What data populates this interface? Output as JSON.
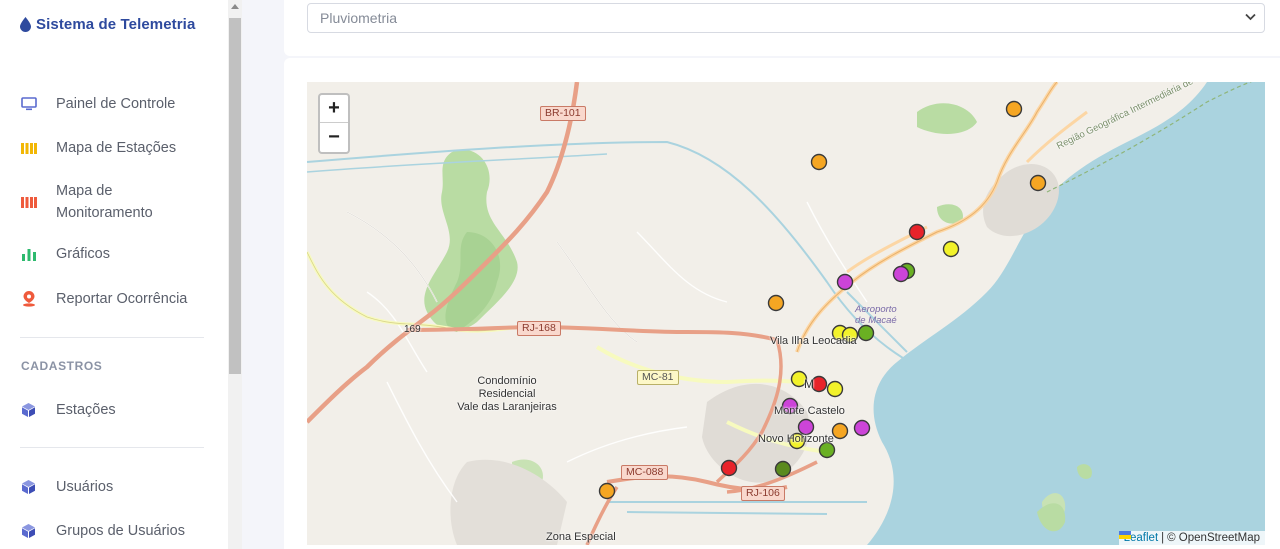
{
  "app": {
    "title": "Sistema de Telemetria"
  },
  "sidebar": {
    "items": [
      {
        "label": "Painel de Controle",
        "icon": "monitor-icon",
        "color": "#5a6acf"
      },
      {
        "label": "Mapa de Estações",
        "icon": "map-stations-icon",
        "color": "#f2b705"
      },
      {
        "label": "Mapa de Monitoramento",
        "icon": "map-monitoring-icon",
        "color": "#ef5a3c"
      },
      {
        "label": "Gráficos",
        "icon": "bar-chart-icon",
        "color": "#2dba6e"
      },
      {
        "label": "Reportar Ocorrência",
        "icon": "location-alert-icon",
        "color": "#ef5a3c"
      }
    ],
    "section_title": "CADASTROS",
    "cadastro_items": [
      {
        "label": "Estações",
        "icon": "cube-icon",
        "color": "#5a6acf"
      },
      {
        "label": "Usuários",
        "icon": "cube-icon",
        "color": "#5a6acf"
      },
      {
        "label": "Grupos de Usuários",
        "icon": "cube-icon",
        "color": "#5a6acf"
      }
    ]
  },
  "filter": {
    "selected": "Pluviometria"
  },
  "map": {
    "zoom_in": "+",
    "zoom_out": "−",
    "attribution_link": "Leaflet",
    "attribution_sep": "|",
    "attribution_text": "© OpenStreetMap",
    "labels": {
      "vila_ilha": "Vila Ilha Leocadia",
      "condominio_1": "Condomínio",
      "condominio_2": "Residencial",
      "condominio_3": "Vale das Laranjeiras",
      "monte_castelo": "Monte Castelo",
      "novo_horizonte": "Novo Horizonte",
      "zona_especial": "Zona Especial",
      "macae_fragment": "M",
      "regiao": "Região Geográfica Intermediária de Macaé",
      "aeroporto_1": "Aeroporto",
      "aeroporto_2": "de Macaé",
      "br101": "BR-101",
      "rj168": "RJ-168",
      "mc81": "MC-81",
      "mc088": "MC-088",
      "rj106": "RJ-106",
      "r169": "169"
    },
    "marker_colors": {
      "orange": "#f5a623",
      "red": "#e8232a",
      "yellow": "#f2f22a",
      "green": "#6ab023",
      "purple": "#cc44d8",
      "darkgreen": "#5b8a1e"
    },
    "stations": [
      {
        "status": "orange"
      },
      {
        "status": "orange"
      },
      {
        "status": "orange"
      },
      {
        "status": "red"
      },
      {
        "status": "yellow"
      },
      {
        "status": "green"
      },
      {
        "status": "purple"
      },
      {
        "status": "purple"
      },
      {
        "status": "orange"
      },
      {
        "status": "yellow"
      },
      {
        "status": "yellow"
      },
      {
        "status": "green"
      },
      {
        "status": "yellow"
      },
      {
        "status": "red"
      },
      {
        "status": "yellow"
      },
      {
        "status": "purple"
      },
      {
        "status": "purple"
      },
      {
        "status": "orange"
      },
      {
        "status": "purple"
      },
      {
        "status": "yellow"
      },
      {
        "status": "green"
      },
      {
        "status": "red"
      },
      {
        "status": "darkgreen"
      },
      {
        "status": "orange"
      }
    ]
  }
}
